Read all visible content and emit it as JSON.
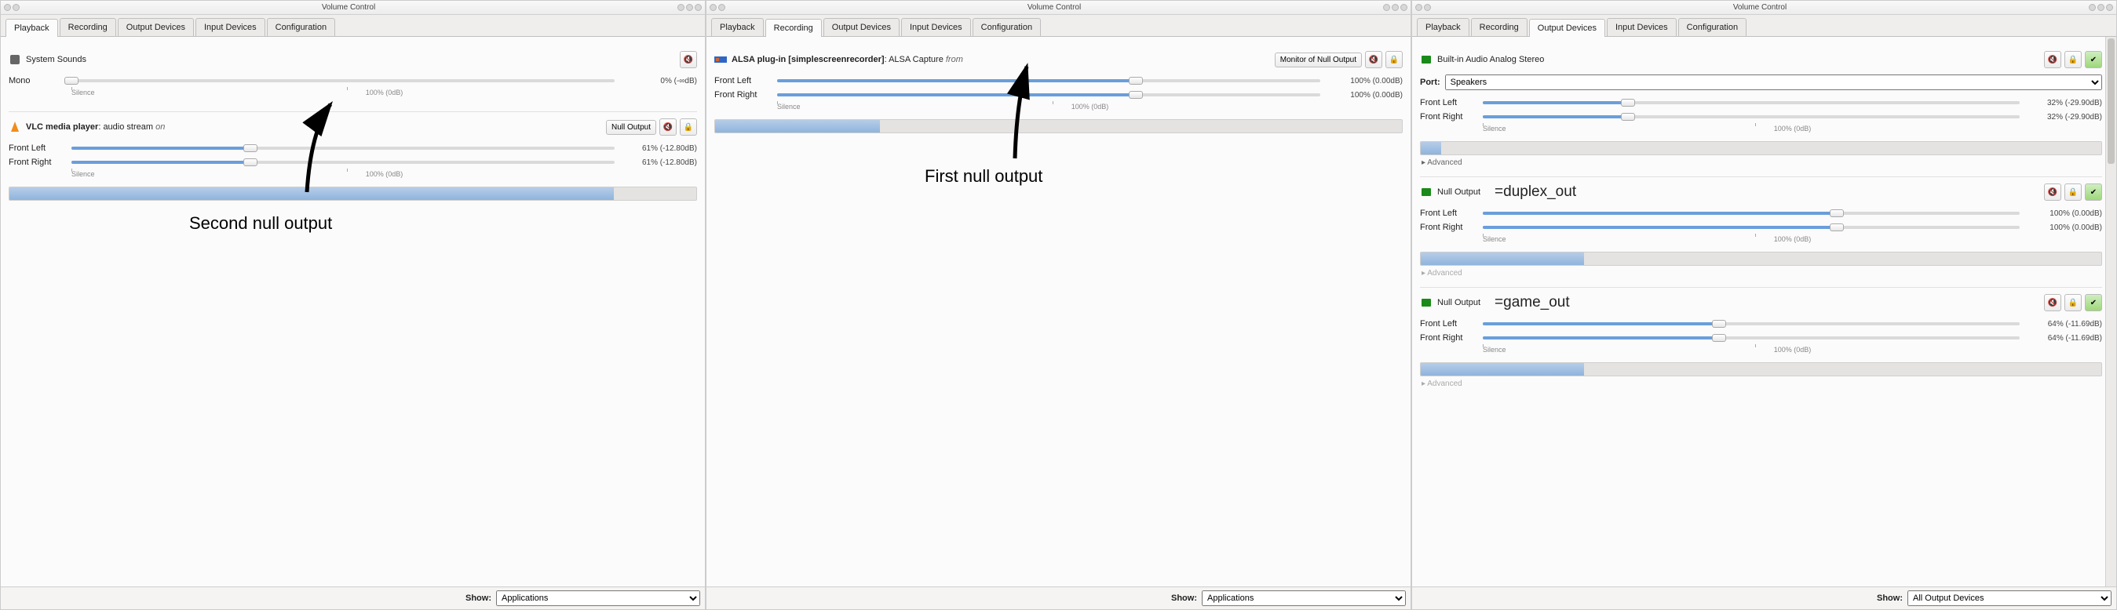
{
  "title": "Volume Control",
  "tabs": [
    "Playback",
    "Recording",
    "Output Devices",
    "Input Devices",
    "Configuration"
  ],
  "footer_label": "Show:",
  "footer_apps": "Applications",
  "footer_outputs": "All Output Devices",
  "scale": {
    "silence": "Silence",
    "mid": "100% (0dB)"
  },
  "advanced": "Advanced",
  "win1": {
    "active_tab": 0,
    "system": {
      "name": "System Sounds",
      "ch": "Mono",
      "pct": 0,
      "db": "0% (-∞dB)"
    },
    "vlc": {
      "name_bold": "VLC media player",
      "name_rest": ": audio stream",
      "name_suffix": "on",
      "target_btn": "Null Output",
      "left": "Front Left",
      "right": "Front Right",
      "pct": 33,
      "db": "61% (-12.80dB)",
      "vu": 88
    }
  },
  "win2": {
    "active_tab": 1,
    "ssr": {
      "name_bold": "ALSA plug-in [simplescreenrecorder]",
      "name_rest": ": ALSA Capture",
      "name_suffix": "from",
      "target_btn": "Monitor of Null Output",
      "left": "Front Left",
      "right": "Front Right",
      "pct": 66,
      "db": "100% (0.00dB)",
      "vu": 24
    }
  },
  "win3": {
    "active_tab": 2,
    "dev1": {
      "name": "Built-in Audio Analog Stereo",
      "port_label": "Port:",
      "port_value": "Speakers",
      "left": "Front Left",
      "right": "Front Right",
      "pct": 27,
      "db": "32% (-29.90dB)",
      "vu": 3
    },
    "dev2": {
      "name": "Null Output",
      "eq": "=duplex_out",
      "left": "Front Left",
      "right": "Front Right",
      "pct": 66,
      "db": "100% (0.00dB)",
      "vu": 24
    },
    "dev3": {
      "name": "Null Output",
      "eq": "=game_out",
      "left": "Front Left",
      "right": "Front Right",
      "pct": 44,
      "db": "64% (-11.69dB)",
      "vu": 24
    }
  },
  "annotations": {
    "second": "Second null output",
    "first": "First null output"
  }
}
